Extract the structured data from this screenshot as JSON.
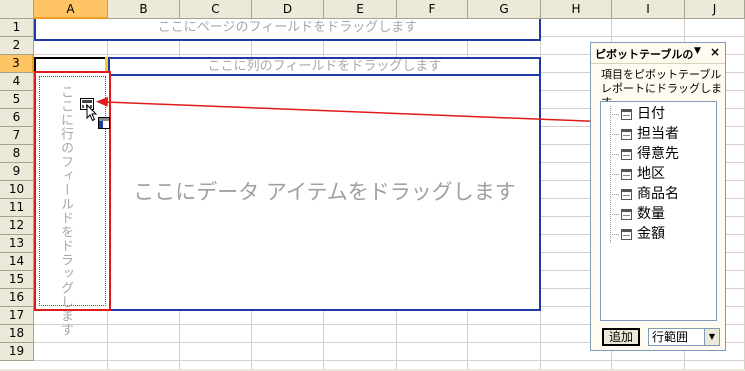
{
  "columns": [
    "A",
    "B",
    "C",
    "D",
    "E",
    "F",
    "G",
    "H",
    "I",
    "J"
  ],
  "rows": [
    "1",
    "2",
    "3",
    "4",
    "5",
    "6",
    "7",
    "8",
    "9",
    "10",
    "11",
    "12",
    "13",
    "14",
    "15",
    "16",
    "17",
    "18",
    "19"
  ],
  "selected_column": "A",
  "selected_row": "3",
  "drop_zones": {
    "page": "ここにページのフィールドをドラッグします",
    "column": "ここに列のフィールドをドラッグします",
    "row": "ここに行のフィールドをドラッグします",
    "data": "ここにデータ アイテムをドラッグします"
  },
  "pivot_panel": {
    "title": "ピボットテーブルの",
    "instruction": "項目をピボットテーブル レポートにドラッグします",
    "fields": [
      "日付",
      "担当者",
      "得意先",
      "地区",
      "商品名",
      "数量",
      "金額"
    ],
    "add_button": "追加",
    "area_select": "行範囲"
  },
  "colors": {
    "dropzone_border": "#1f3aa6",
    "highlight_red": "#e01b1b",
    "header_selected": "#ffc564"
  }
}
